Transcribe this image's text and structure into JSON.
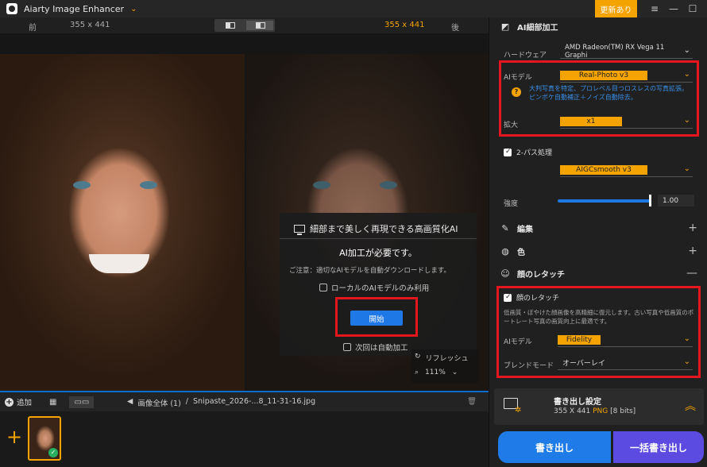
{
  "app": {
    "title": "Aiarty Image Enhancer",
    "update_badge": "更新あり"
  },
  "compare": {
    "before_label": "前",
    "before_size": "355 x 441",
    "after_size": "355 x 441",
    "after_label": "後"
  },
  "modal": {
    "title": "細部まで美しく再現できる高画質化AI",
    "required": "AI加工が必要です。",
    "note": "ご注意：適切なAIモデルを自動ダウンロードします。",
    "local_only": "ローカルのAIモデルのみ利用",
    "start_button": "開始",
    "auto_next": "次回は自動加工"
  },
  "zoom": {
    "refresh": "リフレッシュ",
    "level": "111%"
  },
  "bottombar": {
    "add": "追加",
    "breadcrumb_root": "画像全体 (1)",
    "separator": "/",
    "filename": "Snipaste_2026-...8_11-31-16.jpg"
  },
  "panel": {
    "ai_section": "AI細部加工",
    "hardware_label": "ハードウェア",
    "hardware_value": "AMD Radeon(TM) RX Vega 11 Graphi",
    "ai_model_label": "AIモデル",
    "ai_model_value": "Real-Photo  v3",
    "ai_model_hint": "大判写真を特定、プロレベル目つロスレスの写真拡張。ピンボケ自動補正＋ノイズ自動除去。",
    "scale_label": "拡大",
    "scale_value": "x1",
    "two_pass_label": "2-パス処理",
    "two_pass_value": "AIGCsmooth  v3",
    "strength_label": "強度",
    "strength_value": "1.00",
    "edit_section": "編集",
    "color_section": "色",
    "face_section": "顔のレタッチ",
    "face_check_label": "顔のレタッチ",
    "face_desc": "低画質・ぼやけた顔画像を高精細に復元します。古い写真や低画質のポートレート写真の画質向上に最適です。",
    "face_model_label": "AIモデル",
    "face_model_value": "Fidelity",
    "blend_label": "ブレンドモード",
    "blend_value": "オーバーレイ",
    "export_title": "書き出し設定",
    "export_size": "355 X 441",
    "export_format": "PNG",
    "export_bits": "[8 bits]",
    "export_button": "書き出し",
    "batch_export_button": "一括書き出し"
  }
}
